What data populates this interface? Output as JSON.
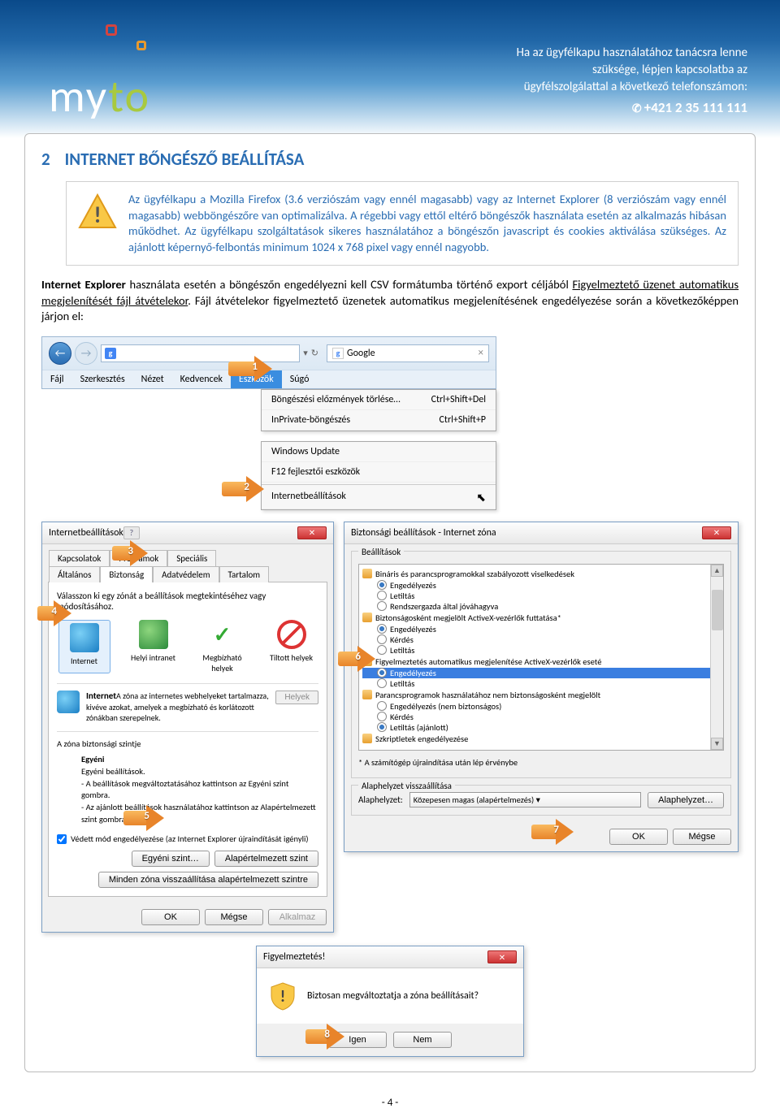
{
  "logo_text_1": "m",
  "logo_text_2": "y",
  "logo_text_3": "t",
  "logo_text_4": "o",
  "header": {
    "line1": "Ha az ügyfélkapu használatához tanácsra lenne",
    "line2": "szüksége, lépjen kapcsolatba az",
    "line3": "ügyfélszolgálattal a következő telefonszámon:",
    "phone": "+421 2 35 111 111"
  },
  "section": {
    "num": "2",
    "title": "INTERNET BŐNGÉSZŐ BEÁLLÍTÁSA"
  },
  "warning": "Az ügyfélkapu a Mozilla Firefox (3.6 verziószám vagy ennél magasabb) vagy az Internet Explorer (8 verziószám vagy ennél magasabb) webböngészőre van optimalizálva. A régebbi vagy ettől eltérő böngészők használata esetén az alkalmazás hibásan működhet. Az ügyfélkapu szolgáltatások sikeres használatához a böngészőn javascript és cookies aktiválása szükséges. Az ajánlott képernyő-felbontás minimum 1024 x 768 pixel vagy ennél nagyobb.",
  "body_p1a": "Internet Explorer",
  "body_p1b": " használata esetén a  böngészőn engedélyezni kell CSV formátumba történő export céljából ",
  "body_p1c": "Figyelmeztető üzenet automatikus megjelenítését fájl átvételekor",
  "body_p1d": ". Fájl átvételekor figyelmeztető üzenetek automatikus megjelenítésének engedélyezése során a következőképpen járjon  el:",
  "ie": {
    "search_engine": "Google",
    "menu": {
      "fajl": "Fájl",
      "szerk": "Szerkesztés",
      "nezet": "Nézet",
      "kedv": "Kedvencek",
      "eszk": "Eszközök",
      "sugo": "Súgó"
    },
    "dd": {
      "r1": "Böngészési előzmények törlése…",
      "r1k": "Ctrl+Shift+Del",
      "r2": "InPrivate-böngészés",
      "r2k": "Ctrl+Shift+P",
      "r3": "Windows Update",
      "r4": "F12 fejlesztői eszközök",
      "r5": "Internetbeállítások"
    }
  },
  "arrows": {
    "1": "1",
    "2": "2",
    "3": "3",
    "4": "4",
    "5": "5",
    "6": "6",
    "7": "7",
    "8": "8"
  },
  "opts": {
    "title": "Internetbeállítások",
    "tabs": {
      "kapcs": "Kapcsolatok",
      "prog": "Programok",
      "spec": "Speciális",
      "alt": "Általános",
      "bizt": "Biztonság",
      "adat": "Adatvédelem",
      "tart": "Tartalom"
    },
    "zone_prompt": "Válasszon ki egy zónát a beállítások megtekintéséhez vagy módosításához.",
    "zones": {
      "int": "Internet",
      "helyi": "Helyi intranet",
      "megb": "Megbízható helyek",
      "tilt": "Tiltott helyek"
    },
    "zone_title": "Internet",
    "zone_desc": "A zóna az internetes webhelyeket tartalmazza, kivéve azokat, amelyek a megbízható és korlátozott zónákban szerepelnek.",
    "helyek": "Helyek",
    "sec_level_label": "A zóna biztonsági szintje",
    "egyeni": "Egyéni",
    "egyeni_l1": "Egyéni beállítások.",
    "egyeni_l2": "- A beállítások megváltoztatásához kattintson az Egyéni szint gombra.",
    "egyeni_l3": "- Az ajánlott beállítások használatához kattintson az Alapértelmezett szint gombra.",
    "protected": "Védett mód engedélyezése (az Internet Explorer újraindítását igényli)",
    "btn_egyeni": "Egyéni szint…",
    "btn_alap": "Alapértelmezett szint",
    "btn_minden": "Minden zóna visszaállítása alapértelmezett szintre",
    "ok": "OK",
    "megse": "Mégse",
    "alkalmaz": "Alkalmaz"
  },
  "sec": {
    "title": "Biztonsági beállítások - Internet zóna",
    "group": "Beállítások",
    "items": {
      "h1": "Bináris és parancsprogramokkal szabályozott viselkedések",
      "r1a": "Engedélyezés",
      "r1b": "Letiltás",
      "r1c": "Rendszergazda által jóváhagyva",
      "h2": "Biztonságosként megjelölt ActiveX-vezérlők futtatása*",
      "r2a": "Engedélyezés",
      "r2b": "Kérdés",
      "r2c": "Letiltás",
      "h3": "Figyelmeztetés automatikus megjelenítése ActiveX-vezérlők eseté",
      "r3a": "Engedélyezés",
      "r3b": "Letiltás",
      "h4": "Parancsprogramok használatához nem biztonságosként megjelölt",
      "r4a": "Engedélyezés (nem biztonságos)",
      "r4b": "Kérdés",
      "r4c": "Letiltás (ajánlott)",
      "h5": "Szkriptletek engedélyezése"
    },
    "note": "* A számítógép újraindítása után lép érvénybe",
    "reset_group": "Alaphelyzet visszaállítása",
    "reset_label": "Alaphelyzet:",
    "reset_val": "Közepesen magas (alapértelmezés)",
    "reset_btn": "Alaphelyzet…",
    "ok": "OK",
    "megse": "Mégse"
  },
  "confirm": {
    "title": "Figyelmeztetés!",
    "msg": "Biztosan megváltoztatja a zóna beállításait?",
    "igen": "Igen",
    "nem": "Nem"
  },
  "pagenum": "- 4 -"
}
